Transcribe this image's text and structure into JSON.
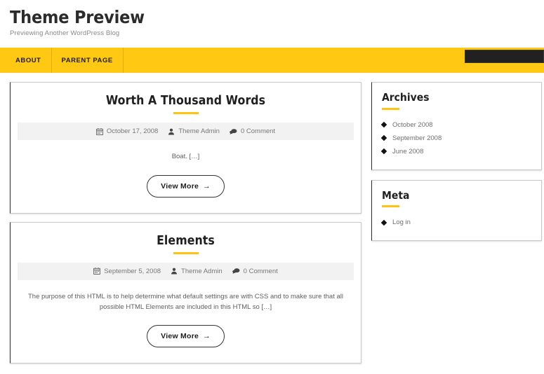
{
  "header": {
    "site_title": "Theme Preview",
    "tagline": "Previewing Another WordPress Blog"
  },
  "nav": {
    "items": [
      {
        "label": "About"
      },
      {
        "label": "Parent Page"
      }
    ],
    "search_placeholder": "",
    "search_value": ""
  },
  "theme": {
    "accent_yellow": "#ffc412",
    "nav_yellow": "#ffc812",
    "search_dark": "#212121",
    "meta_bg": "#f2f2f2",
    "text_dark": "#1f1f1f",
    "text_muted": "#777777"
  },
  "posts": [
    {
      "title": "Worth A Thousand Words",
      "date": "October 17, 2008",
      "author": "Theme Admin",
      "comments": "0 Comment",
      "excerpt": "Boat. […]",
      "button_label": "View More",
      "button_arrow": "→"
    },
    {
      "title": "Elements",
      "date": "September 5, 2008",
      "author": "Theme Admin",
      "comments": "0 Comment",
      "excerpt": "The purpose of this HTML is to help determine what default settings are with CSS and to make sure that all possible HTML Elements are included in this HTML so […]",
      "button_label": "View More",
      "button_arrow": "→"
    }
  ],
  "sidebar": {
    "widgets": [
      {
        "title": "Archives",
        "items": [
          {
            "label": "October 2008"
          },
          {
            "label": "September 2008"
          },
          {
            "label": "June 2008"
          }
        ]
      },
      {
        "title": "Meta",
        "items": [
          {
            "label": "Log in"
          }
        ]
      }
    ]
  }
}
